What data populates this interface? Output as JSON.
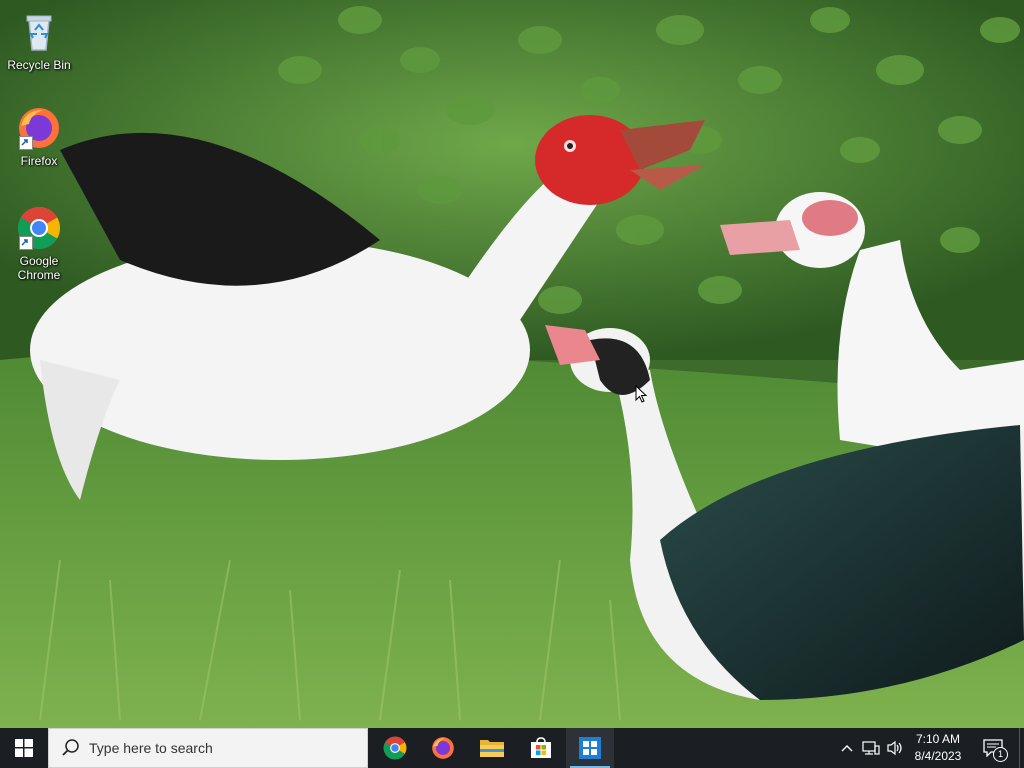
{
  "desktop": {
    "icons": [
      {
        "label": "Recycle Bin",
        "icon": "recycle-bin-icon"
      },
      {
        "label": "Firefox",
        "icon": "firefox-icon"
      },
      {
        "label": "Google Chrome",
        "icon": "chrome-icon"
      }
    ],
    "wallpaper": "ducks-on-grass"
  },
  "taskbar": {
    "start_icon": "windows-logo-icon",
    "search_placeholder": "Type here to search",
    "pinned_apps": [
      {
        "name": "Google Chrome",
        "icon": "chrome-icon"
      },
      {
        "name": "Firefox",
        "icon": "firefox-icon"
      },
      {
        "name": "File Explorer",
        "icon": "folder-icon"
      },
      {
        "name": "Microsoft Store",
        "icon": "store-icon"
      },
      {
        "name": "Windows Setup",
        "icon": "windows-app-icon",
        "active": true
      }
    ],
    "tray": {
      "time": "7:10 AM",
      "date": "8/4/2023",
      "notification_count": "1"
    }
  },
  "colors": {
    "taskbar_bg": "#1b1f24",
    "accent": "#76b9ed"
  }
}
